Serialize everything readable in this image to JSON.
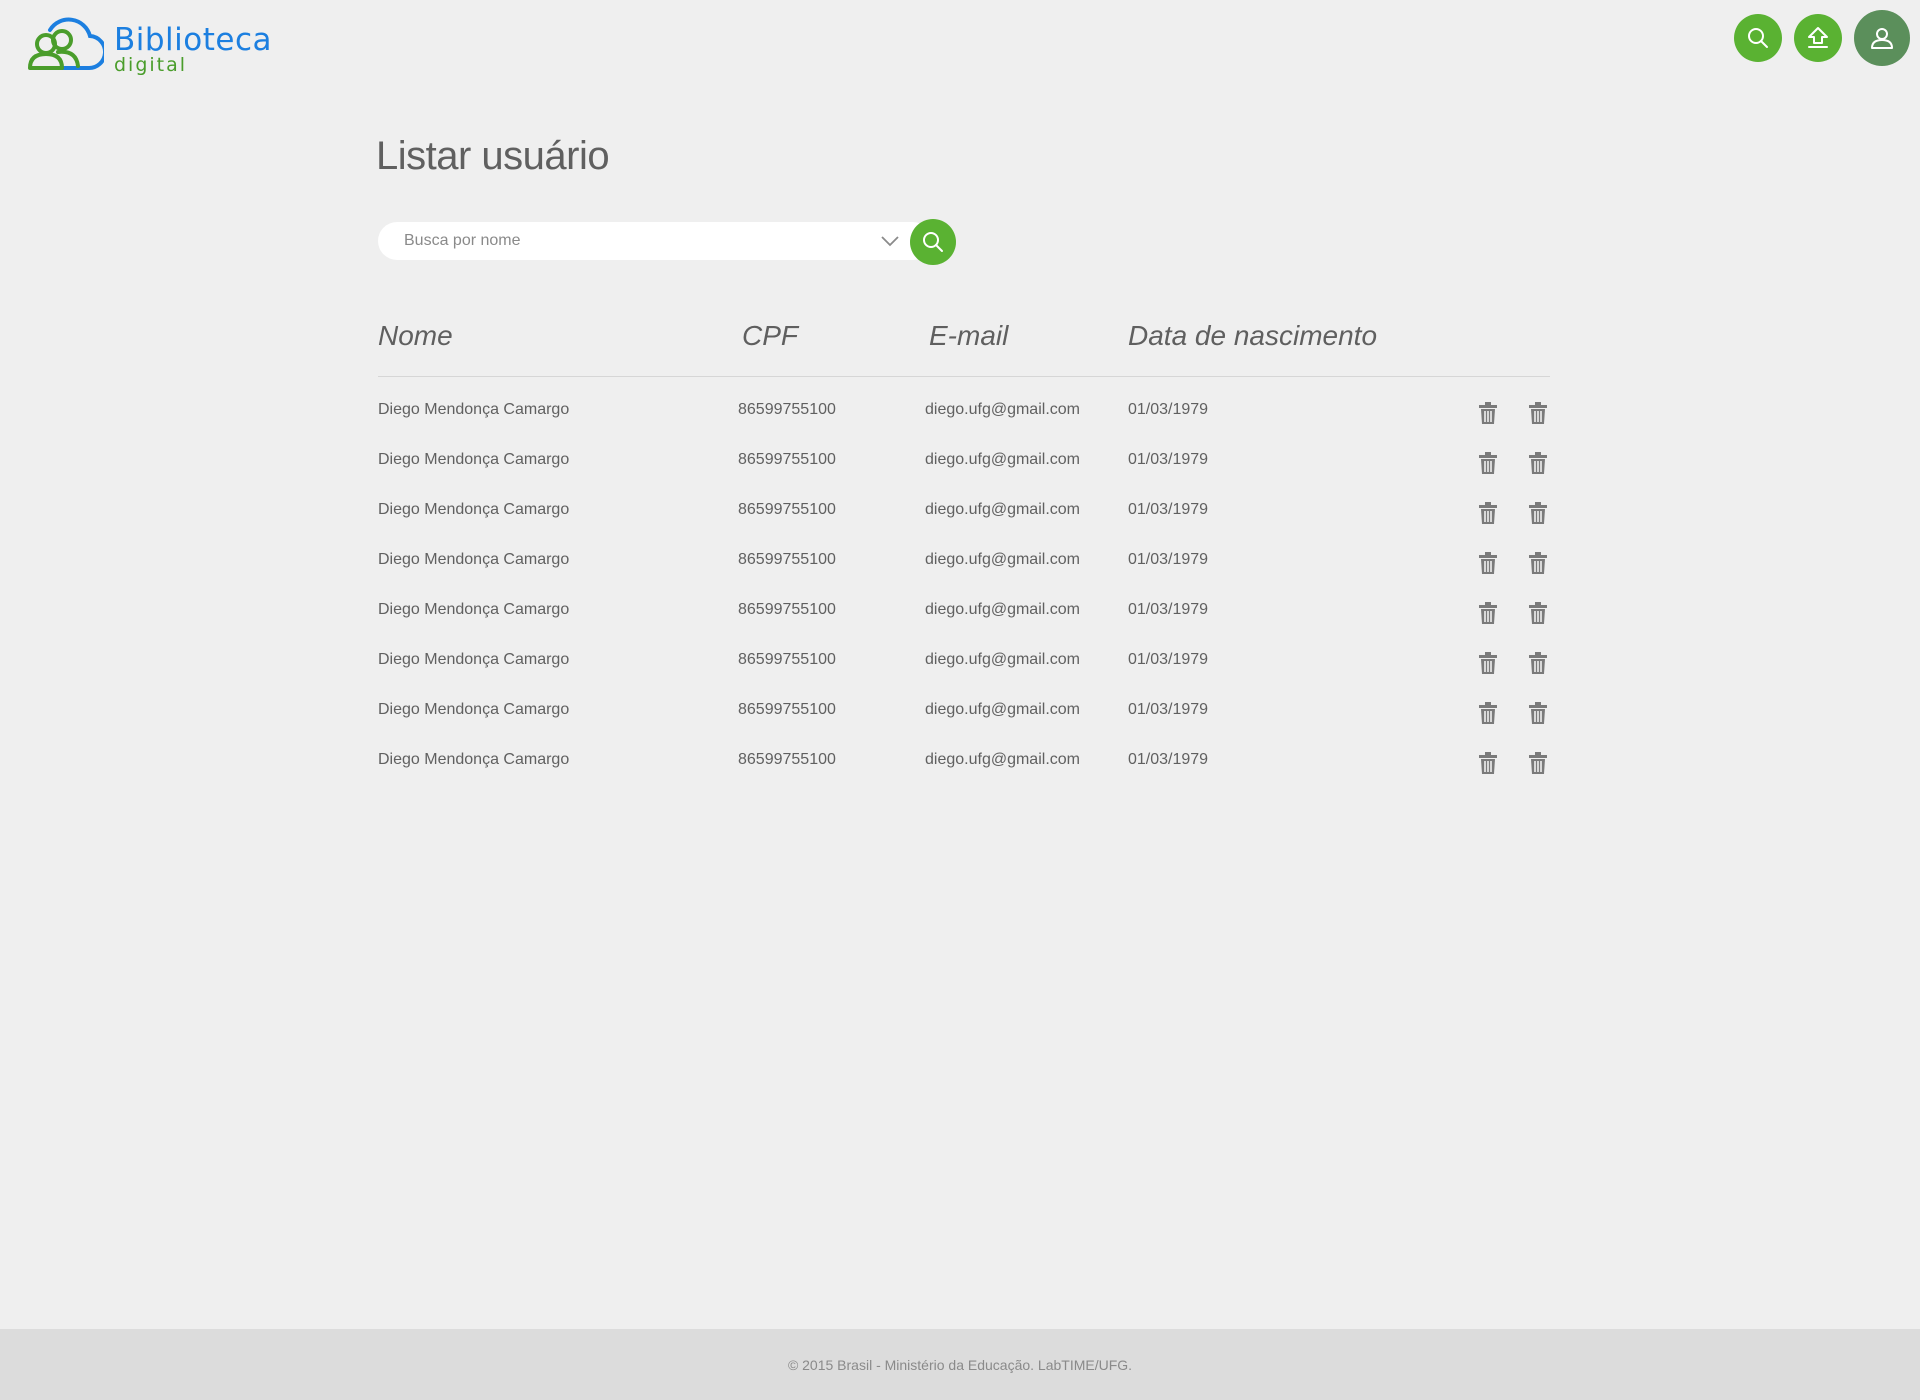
{
  "brand": {
    "title": "Biblioteca",
    "subtitle": "digital",
    "primary_color": "#1c7fe0",
    "accent_color": "#5ab232"
  },
  "header": {
    "buttons": [
      {
        "name": "search",
        "icon": "search-icon"
      },
      {
        "name": "upload",
        "icon": "upload-icon"
      },
      {
        "name": "user",
        "icon": "user-icon"
      }
    ]
  },
  "main": {
    "title": "Listar usuário",
    "search": {
      "placeholder": "Busca por nome",
      "value": ""
    }
  },
  "table": {
    "columns": [
      "Nome",
      "CPF",
      "E-mail",
      "Data de nascimento"
    ],
    "rows": [
      {
        "nome": "Diego Mendonça Camargo",
        "cpf": "86599755100",
        "email": "diego.ufg@gmail.com",
        "nascimento": "01/03/1979"
      },
      {
        "nome": "Diego Mendonça Camargo",
        "cpf": "86599755100",
        "email": "diego.ufg@gmail.com",
        "nascimento": "01/03/1979"
      },
      {
        "nome": "Diego Mendonça Camargo",
        "cpf": "86599755100",
        "email": "diego.ufg@gmail.com",
        "nascimento": "01/03/1979"
      },
      {
        "nome": "Diego Mendonça Camargo",
        "cpf": "86599755100",
        "email": "diego.ufg@gmail.com",
        "nascimento": "01/03/1979"
      },
      {
        "nome": "Diego Mendonça Camargo",
        "cpf": "86599755100",
        "email": "diego.ufg@gmail.com",
        "nascimento": "01/03/1979"
      },
      {
        "nome": "Diego Mendonça Camargo",
        "cpf": "86599755100",
        "email": "diego.ufg@gmail.com",
        "nascimento": "01/03/1979"
      },
      {
        "nome": "Diego Mendonça Camargo",
        "cpf": "86599755100",
        "email": "diego.ufg@gmail.com",
        "nascimento": "01/03/1979"
      },
      {
        "nome": "Diego Mendonça Camargo",
        "cpf": "86599755100",
        "email": "diego.ufg@gmail.com",
        "nascimento": "01/03/1979"
      }
    ],
    "row_actions": [
      "trash-icon",
      "trash-icon"
    ]
  },
  "footer": {
    "text": "© 2015 Brasil - Ministério da Educação. LabTIME/UFG."
  }
}
